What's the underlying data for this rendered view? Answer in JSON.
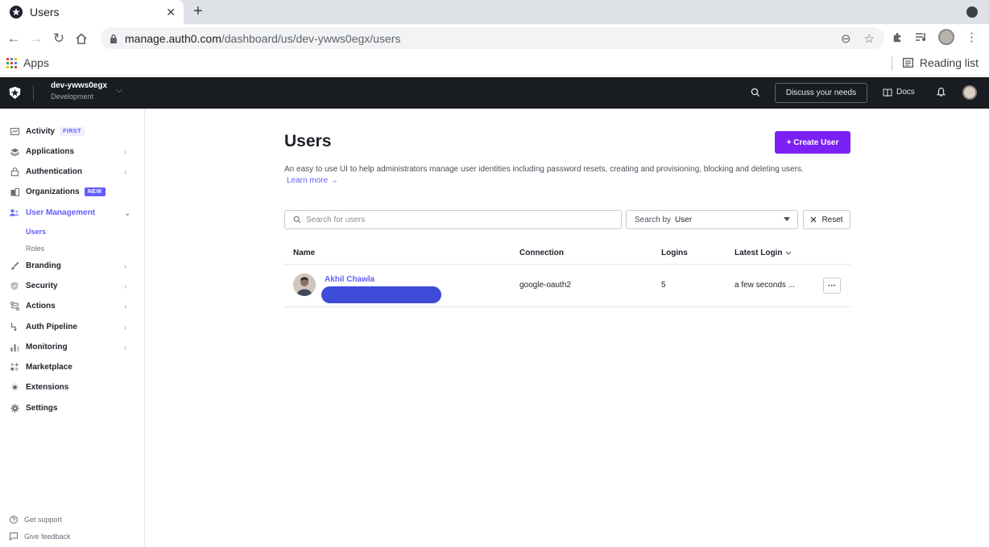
{
  "browser": {
    "tab_title": "Users",
    "tab_close": "✕",
    "new_tab": "+",
    "url_host": "manage.auth0.com",
    "url_path": "/dashboard/us/dev-ywws0egx/users",
    "bookmarks": {
      "apps_label": "Apps",
      "reading_list_label": "Reading list"
    }
  },
  "header": {
    "tenant_name": "dev-ywws0egx",
    "tenant_env": "Development",
    "discuss_label": "Discuss your needs",
    "docs_label": "Docs"
  },
  "sidebar": {
    "items": [
      {
        "label": "Activity",
        "badge": "FIRST"
      },
      {
        "label": "Applications"
      },
      {
        "label": "Authentication"
      },
      {
        "label": "Organizations",
        "badge": "NEW"
      },
      {
        "label": "User Management"
      },
      {
        "label": "Branding"
      },
      {
        "label": "Security"
      },
      {
        "label": "Actions"
      },
      {
        "label": "Auth Pipeline"
      },
      {
        "label": "Monitoring"
      },
      {
        "label": "Marketplace"
      },
      {
        "label": "Extensions"
      },
      {
        "label": "Settings"
      }
    ],
    "subitems": [
      {
        "label": "Users"
      },
      {
        "label": "Roles"
      }
    ],
    "footer": {
      "support_label": "Get support",
      "feedback_label": "Give feedback"
    }
  },
  "main": {
    "title": "Users",
    "create_button": "+ Create User",
    "description": "An easy to use UI to help administrators manage user identities including password resets, creating and provisioning, blocking and deleting users.",
    "learn_more": "Learn more →",
    "search_placeholder": "Search for users",
    "search_by_label": "Search by",
    "search_by_value": "User",
    "reset_label": "Reset",
    "table": {
      "headers": {
        "name": "Name",
        "connection": "Connection",
        "logins": "Logins",
        "latest_login": "Latest Login"
      },
      "rows": [
        {
          "name": "Akhil Chawla",
          "connection": "google-oauth2",
          "logins": "5",
          "latest_login": "a few seconds ...",
          "actions": "···"
        }
      ]
    }
  },
  "colors": {
    "accent": "#635dff",
    "primary_button": "#7c21f5",
    "header_bg": "#191c21"
  }
}
